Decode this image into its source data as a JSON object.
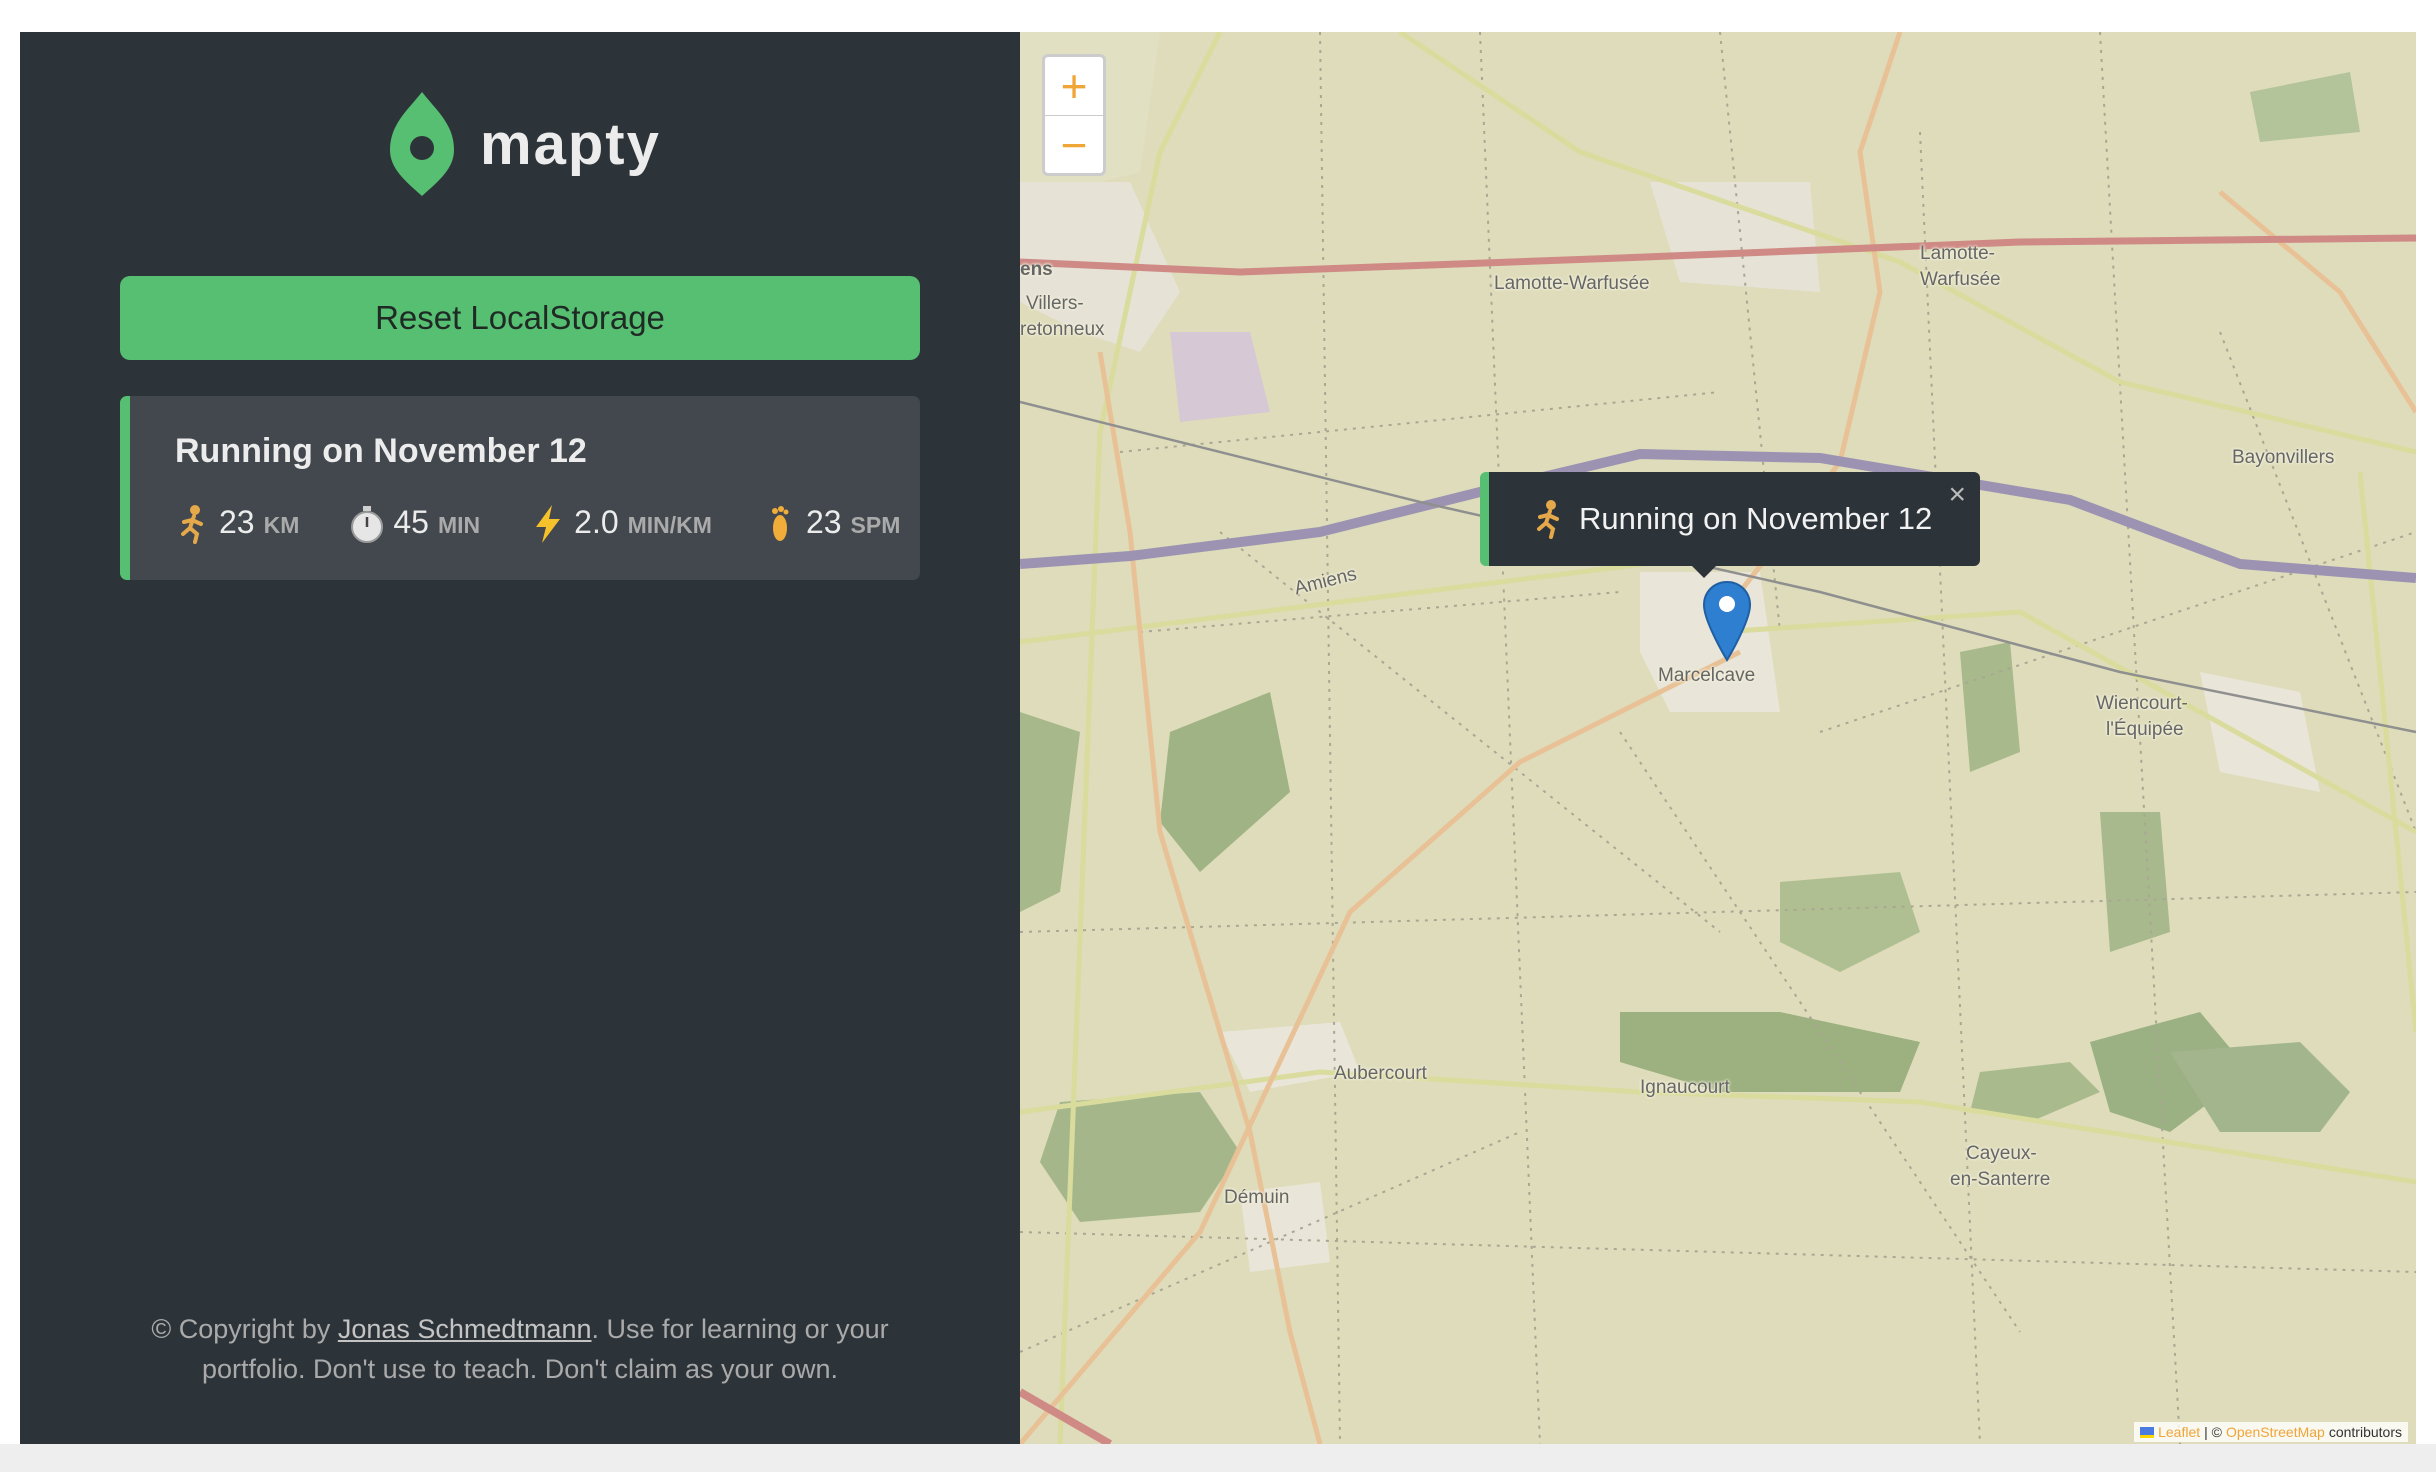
{
  "app": {
    "logo_text": "mapty",
    "logo_icon": "map-pin-icon",
    "brand_color": "#57bf72"
  },
  "sidebar": {
    "reset_button": "Reset LocalStorage",
    "workouts": [
      {
        "title": "Running on November 12",
        "details": [
          {
            "icon": "runner-icon",
            "value": "23",
            "unit": "KM"
          },
          {
            "icon": "stopwatch-icon",
            "value": "45",
            "unit": "MIN"
          },
          {
            "icon": "lightning-icon",
            "value": "2.0",
            "unit": "MIN/KM"
          },
          {
            "icon": "footprint-icon",
            "value": "23",
            "unit": "SPM"
          }
        ]
      }
    ],
    "copyright": {
      "prefix": "© Copyright by ",
      "author": "Jonas Schmedtmann",
      "suffix": ". Use for learning or your portfolio. Don't use to teach. Don't claim as your own."
    }
  },
  "map": {
    "zoom_in": "+",
    "zoom_out": "−",
    "popup": {
      "icon": "runner-icon",
      "text": "Running on November 12",
      "close": "×"
    },
    "place_labels": {
      "ens": "ens",
      "villers": "Villers-",
      "bretonneux": "retonneux",
      "lamotte_warfusee": "Lamotte-Warfusée",
      "lamotte": "Lamotte-",
      "warfusee": "Warfusée",
      "bayonvillers": "Bayonvillers",
      "amiens": "Amiens",
      "marcelcave": "Marcelcave",
      "wiencourt": "Wiencourt-",
      "lequipee": "l'Équipée",
      "aubercourt": "Aubercourt",
      "ignaucourt": "Ignaucourt",
      "demuin": "Démuin",
      "cayeux": "Cayeux-",
      "en_santerre": "en-Santerre"
    },
    "attribution": {
      "leaflet": "Leaflet",
      "separator": "| ©",
      "osm": "OpenStreetMap",
      "contributors": "contributors"
    }
  }
}
